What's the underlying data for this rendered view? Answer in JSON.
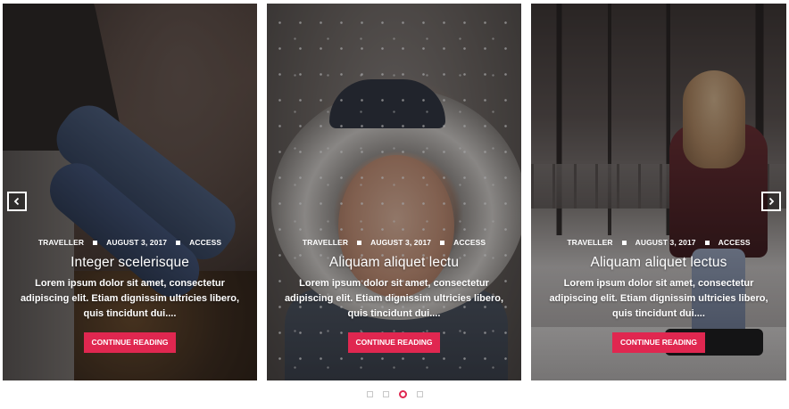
{
  "slides": [
    {
      "meta": [
        "Traveller",
        "August 3, 2017",
        "Access"
      ],
      "title": "Integer scelerisque",
      "excerpt": "Lorem ipsum dolor sit amet, consectetur adipiscing elit. Etiam dignissim ultricies libero, quis tincidunt dui....",
      "button_label": "Continue Reading"
    },
    {
      "meta": [
        "Traveller",
        "August 3, 2017",
        "Access"
      ],
      "title": "Aliquam aliquet lectu",
      "excerpt": "Lorem ipsum dolor sit amet, consectetur adipiscing elit. Etiam dignissim ultricies libero, quis tincidunt dui....",
      "button_label": "Continue Reading"
    },
    {
      "meta": [
        "Traveller",
        "August 3, 2017",
        "Access"
      ],
      "title": "Aliquam aliquet lectus",
      "excerpt": "Lorem ipsum dolor sit amet, consectetur adipiscing elit. Etiam dignissim ultricies libero, quis tincidunt dui....",
      "button_label": "Continue Reading"
    }
  ],
  "navigation": {
    "prev_icon": "chevron-left-icon",
    "next_icon": "chevron-right-icon"
  },
  "pagination": {
    "count": 4,
    "active_index": 2
  },
  "colors": {
    "accent": "#e02750",
    "text": "#ffffff"
  }
}
